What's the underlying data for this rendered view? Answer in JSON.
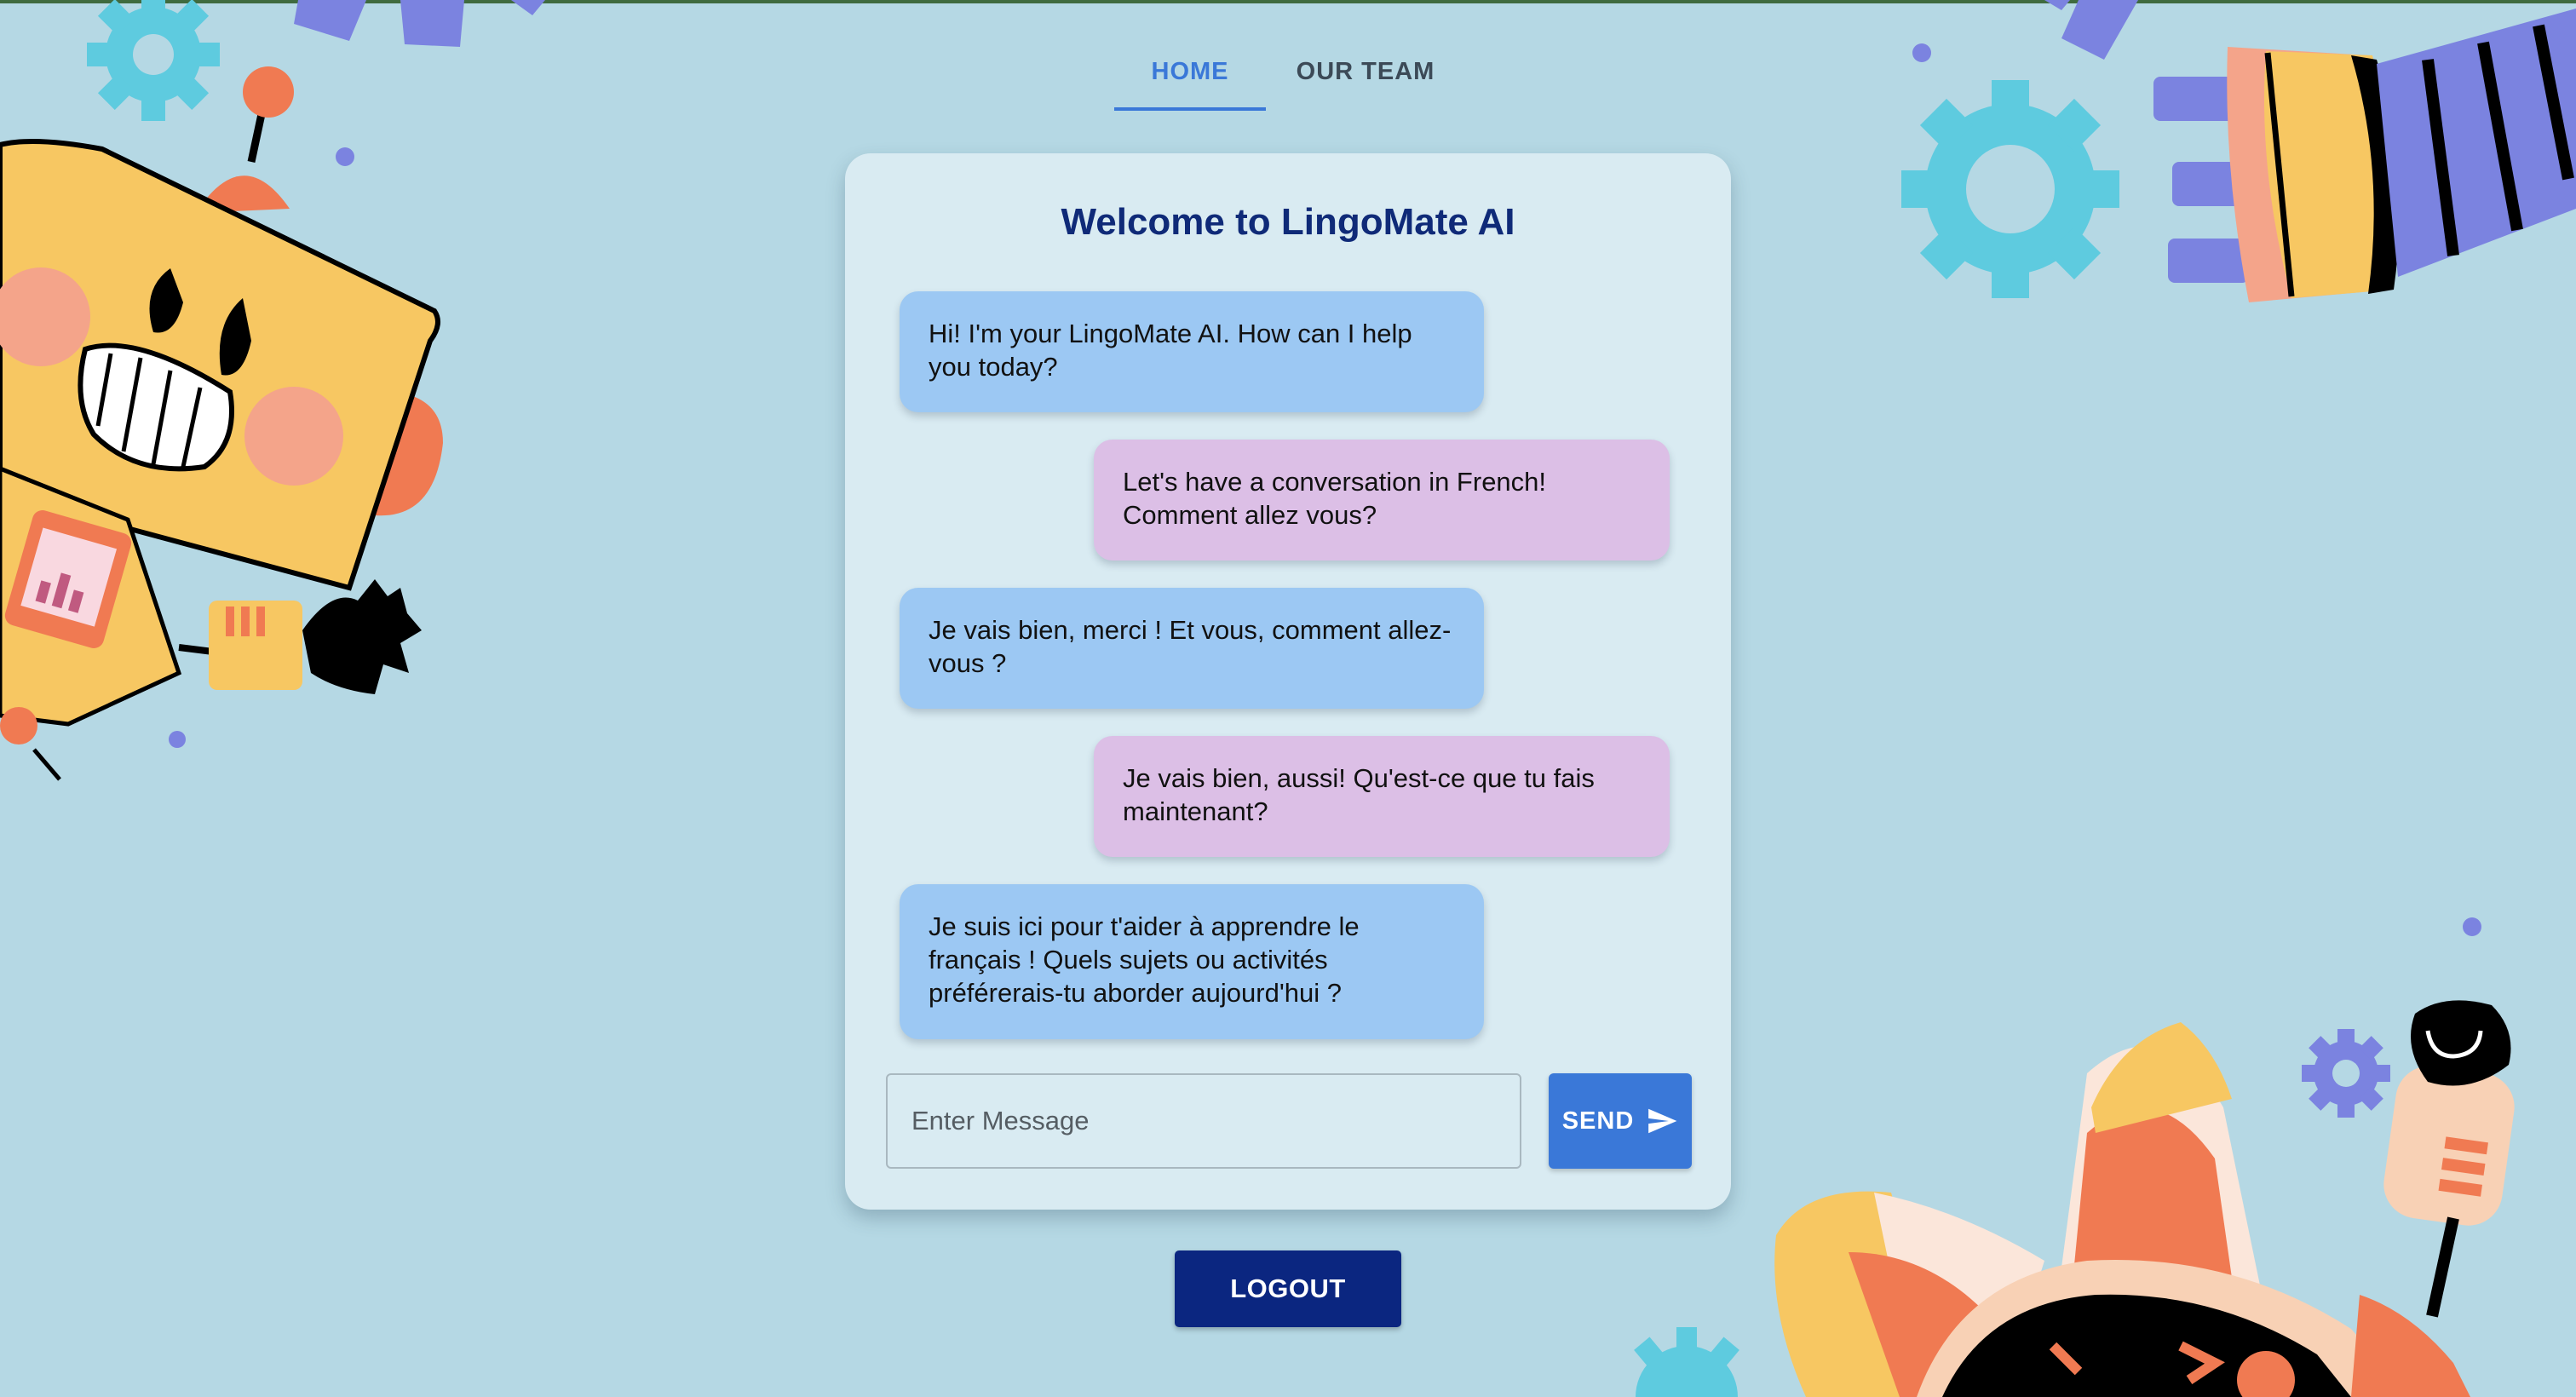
{
  "nav": {
    "tabs": [
      {
        "label": "HOME",
        "active": true
      },
      {
        "label": "OUR TEAM",
        "active": false
      }
    ]
  },
  "chat": {
    "title": "Welcome to LingoMate AI",
    "messages": [
      {
        "sender": "bot",
        "text": "Hi! I'm your LingoMate AI. How can I help you today?"
      },
      {
        "sender": "user",
        "text": "Let's have a conversation in French! Comment allez vous?"
      },
      {
        "sender": "bot",
        "text": "Je vais bien, merci ! Et vous, comment allez-vous ?"
      },
      {
        "sender": "user",
        "text": "Je vais bien, aussi! Qu'est-ce que tu fais maintenant?"
      },
      {
        "sender": "bot",
        "text": "Je suis ici pour t'aider à apprendre le français ! Quels sujets ou activités préférerais-tu aborder aujourd'hui ?"
      }
    ],
    "input": {
      "placeholder": "Enter Message",
      "value": ""
    },
    "send_label": "SEND",
    "send_icon": "send-arrow-icon"
  },
  "logout_label": "LOGOUT",
  "colors": {
    "background": "#b5d8e4",
    "card": "#d9ebf2",
    "title": "#0f2a78",
    "bot_bubble": "#9cc8f3",
    "user_bubble": "#dcbfe6",
    "accent": "#3a78d8",
    "logout": "#0b2680"
  },
  "decorations": [
    "robot-illustration-left",
    "robot-arm-illustration-top-right",
    "cat-robot-illustration-bottom-right",
    "gear-icon"
  ]
}
